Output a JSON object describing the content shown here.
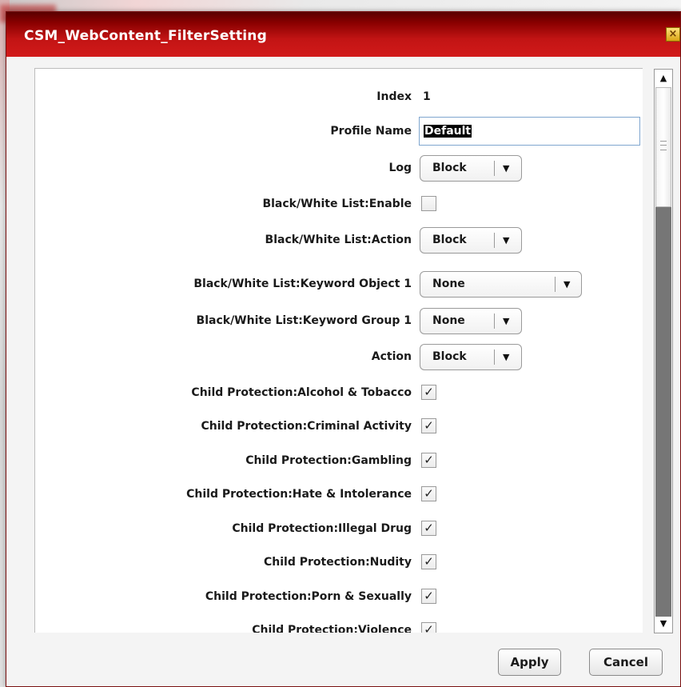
{
  "dialog": {
    "title": "CSM_WebContent_FilterSetting",
    "close_icon": "close-icon",
    "apply_label": "Apply",
    "cancel_label": "Cancel"
  },
  "form": {
    "index": {
      "label": "Index",
      "value": "1"
    },
    "profile_name": {
      "label": "Profile Name",
      "value": "Default"
    },
    "log": {
      "label": "Log",
      "value": "Block"
    },
    "bw_enable": {
      "label": "Black/White List:Enable",
      "checked": false
    },
    "bw_action": {
      "label": "Black/White List:Action",
      "value": "Block"
    },
    "bw_keyword_object": {
      "label": "Black/White List:Keyword Object 1",
      "value": "None"
    },
    "bw_keyword_group": {
      "label": "Black/White List:Keyword Group 1",
      "value": "None"
    },
    "action": {
      "label": "Action",
      "value": "Block"
    },
    "child_protection": [
      {
        "label": "Child Protection:Alcohol & Tobacco",
        "checked": true
      },
      {
        "label": "Child Protection:Criminal Activity",
        "checked": true
      },
      {
        "label": "Child Protection:Gambling",
        "checked": true
      },
      {
        "label": "Child Protection:Hate & Intolerance",
        "checked": true
      },
      {
        "label": "Child Protection:Illegal Drug",
        "checked": true
      },
      {
        "label": "Child Protection:Nudity",
        "checked": true
      },
      {
        "label": "Child Protection:Porn & Sexually",
        "checked": true
      },
      {
        "label": "Child Protection:Violence",
        "checked": true
      }
    ],
    "check_glyph": "✓",
    "dropdown_arrow": "▼"
  },
  "scrollbar": {
    "up_arrow": "▲",
    "down_arrow": "▼"
  }
}
